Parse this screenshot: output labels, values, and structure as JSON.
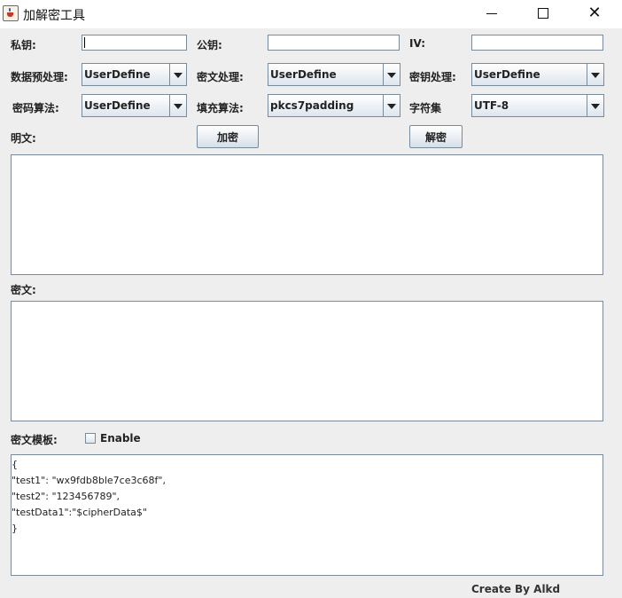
{
  "window": {
    "title": "加解密工具"
  },
  "fields": {
    "private_key_label": "私钥:",
    "public_key_label": "公钥:",
    "iv_label": "IV:",
    "private_key_value": "",
    "public_key_value": "",
    "iv_value": ""
  },
  "options": {
    "data_preprocess_label": "数据预处理:",
    "data_preprocess_value": "UserDefine",
    "cipher_process_label": "密文处理:",
    "cipher_process_value": "UserDefine",
    "key_process_label": "密钥处理:",
    "key_process_value": "UserDefine",
    "algorithm_label": "密码算法:",
    "algorithm_value": "UserDefine",
    "padding_label": "填充算法:",
    "padding_value": "pkcs7padding",
    "charset_label": "字符集",
    "charset_value": "UTF-8"
  },
  "actions": {
    "plaintext_label": "明文:",
    "encrypt_label": "加密",
    "decrypt_label": "解密"
  },
  "ciphertext": {
    "label": "密文:"
  },
  "template": {
    "label": "密文模板:",
    "enable_label": "Enable",
    "enabled": false,
    "text": "{\n\"test1\": \"wx9fdb8ble7ce3c68f\",\n\"test2\": \"123456789\",\n\"testData1\":\"$cipherData$\"\n}"
  },
  "footer": {
    "credit": "Create By Alkd"
  }
}
